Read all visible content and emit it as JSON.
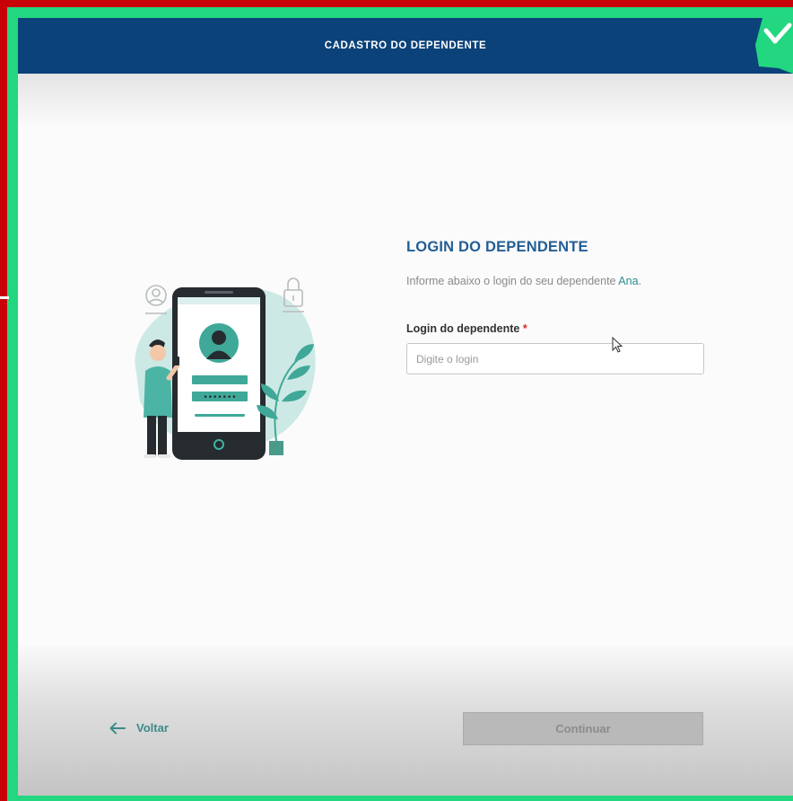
{
  "header": {
    "title": "CADASTRO DO DEPENDENTE"
  },
  "form": {
    "title": "LOGIN DO DEPENDENTE",
    "description_prefix": "Informe abaixo o login do seu dependente ",
    "dependent_name": "Ana",
    "description_suffix": ".",
    "field_label": "Login do dependente",
    "required_mark": "*",
    "login_value": "",
    "login_placeholder": "Digite o login"
  },
  "footer": {
    "back_label": "Voltar",
    "continue_label": "Continuar",
    "continue_enabled": false
  },
  "illustration": {
    "password_mask": "•••••••"
  },
  "icons": {
    "back": "arrow-left-icon",
    "badge": "checkmark-icon",
    "cursor": "mouse-cursor-icon"
  },
  "colors": {
    "header_bg": "#0a4279",
    "accent": "#2a8c8c",
    "title": "#235e94",
    "required": "#d22d2d",
    "frame_green": "#23d680",
    "frame_red": "#c8000a"
  }
}
